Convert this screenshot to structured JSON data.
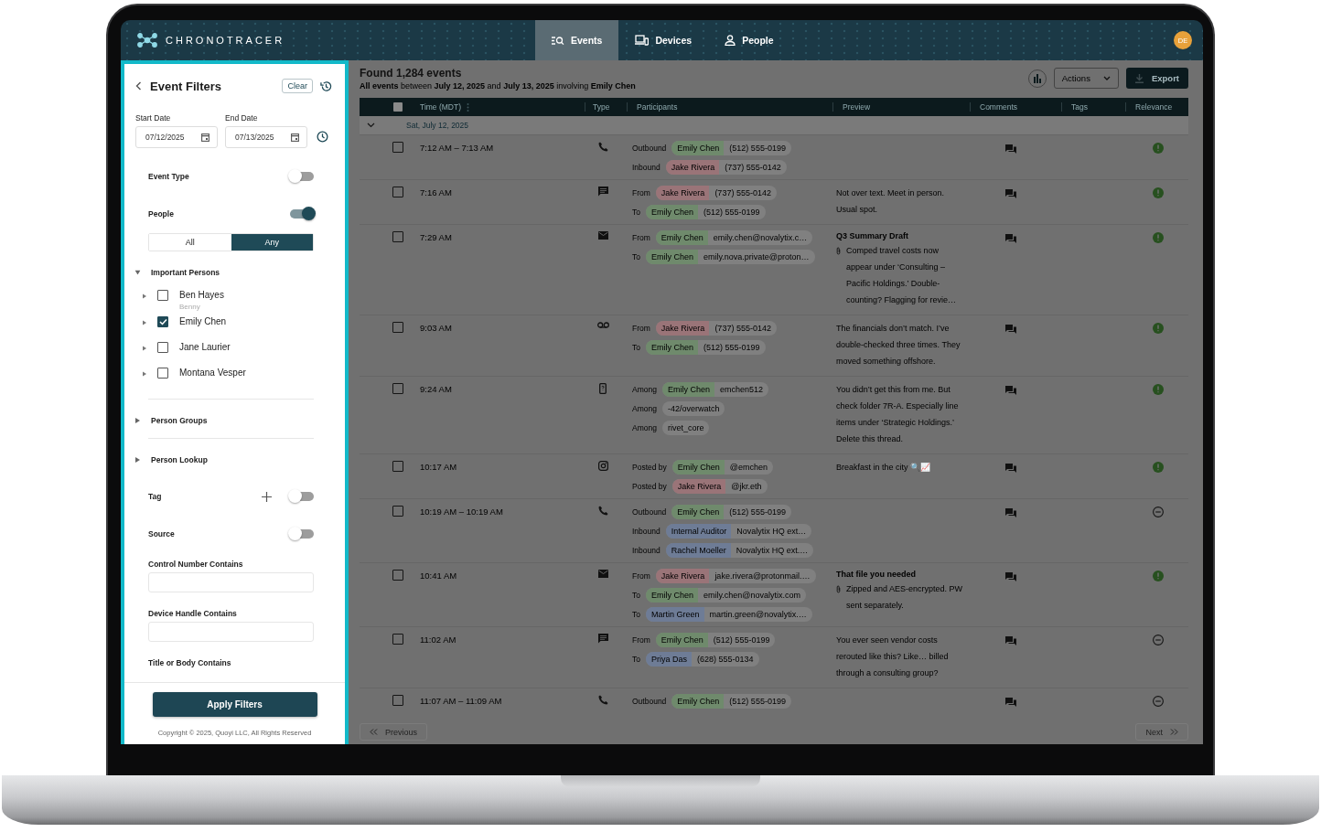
{
  "app": {
    "logo": "CHRONOTRACER",
    "avatar": "DE"
  },
  "nav": [
    {
      "label": "Events",
      "kind": "events",
      "selected": true
    },
    {
      "label": "Devices",
      "kind": "devices",
      "selected": false
    },
    {
      "label": "People",
      "kind": "people",
      "selected": false
    }
  ],
  "filters": {
    "title": "Event Filters",
    "clear": "Clear",
    "start_date": {
      "label": "Start Date",
      "value": "07/12/2025"
    },
    "end_date": {
      "label": "End Date",
      "value": "07/13/2025"
    },
    "items": [
      {
        "kind": "toggle",
        "label": "Event Type",
        "on": false
      },
      {
        "kind": "toggle",
        "label": "People",
        "on": true
      },
      {
        "kind": "segmented",
        "options": [
          {
            "label": "All",
            "selected": false
          },
          {
            "label": "Any",
            "selected": true
          }
        ]
      },
      {
        "kind": "group",
        "label": "Important Persons",
        "expanded": true,
        "people": [
          {
            "name": "Ben Hayes",
            "alias": "Benny",
            "checked": false,
            "expanded": false
          },
          {
            "name": "Emily Chen",
            "checked": true,
            "expanded": false
          },
          {
            "name": "Jane Laurier",
            "checked": false,
            "expanded": false
          },
          {
            "name": "Montana Vesper",
            "checked": false,
            "expanded": false
          }
        ]
      },
      {
        "kind": "group",
        "label": "Person Groups",
        "expanded": false
      },
      {
        "kind": "group",
        "label": "Person Lookup",
        "expanded": false
      },
      {
        "kind": "add_toggle",
        "label": "Tag",
        "on": false
      },
      {
        "kind": "toggle",
        "label": "Source",
        "on": false
      },
      {
        "kind": "text_field",
        "label": "Control Number Contains"
      },
      {
        "kind": "text_field",
        "label": "Device Handle Contains"
      },
      {
        "kind": "text_field",
        "label": "Title or Body Contains"
      }
    ],
    "apply": "Apply Filters",
    "copyright": "Copyright © 2025, Quoyi LLC, All Rights Reserved"
  },
  "results": {
    "title": "Found 1,284 events",
    "subtitle": "**All events** between **July 12, 2025** and **July 13, 2025** involving **Emily Chen**",
    "actions": "Actions",
    "export": "Export"
  },
  "table": {
    "select_all_checked": false,
    "columns": [
      "Time (MDT)",
      "Type",
      "Participants",
      "Preview",
      "Comments",
      "Tags",
      "Relevance"
    ],
    "group": {
      "label": "Sat, July 12, 2025",
      "expanded": true
    },
    "rows": [
      {
        "time": "7:12 AM – 7:13 AM",
        "kind": "call",
        "checked": false,
        "flagged": true,
        "participants": [
          {
            "role": "Outbound",
            "name": "Emily Chen",
            "handle": "(512) 555-0199",
            "color": "#6f8a6c"
          },
          {
            "role": "Inbound",
            "name": "Jake Rivera",
            "handle": "(737) 555-0142",
            "color": "#9a7478"
          }
        ]
      },
      {
        "time": "7:16 AM",
        "kind": "sms",
        "checked": false,
        "flagged": true,
        "participants": [
          {
            "role": "From",
            "name": "Jake Rivera",
            "handle": "(737) 555-0142",
            "color": "#9a7478"
          },
          {
            "role": "To",
            "name": "Emily Chen",
            "handle": "(512) 555-0199",
            "color": "#6f8a6c"
          }
        ],
        "preview": {
          "text": "Not over text. Meet in person. Usual spot."
        }
      },
      {
        "time": "7:29 AM",
        "kind": "email",
        "checked": false,
        "flagged": true,
        "participants": [
          {
            "role": "From",
            "name": "Emily Chen",
            "handle": "emily.chen@novalytix.c…",
            "color": "#6f8a6c"
          },
          {
            "role": "To",
            "name": "Emily Chen",
            "handle": "emily.nova.private@proton…",
            "color": "#6f8a6c"
          }
        ],
        "preview": {
          "title": "Q3 Summary Draft",
          "attachment": true,
          "text": "Comped travel costs now appear under ‘Consulting – Pacific Holdings.’ Double-counting? Flagging for revie…"
        }
      },
      {
        "time": "9:03 AM",
        "kind": "voicemail",
        "checked": false,
        "flagged": true,
        "participants": [
          {
            "role": "From",
            "name": "Jake Rivera",
            "handle": "(737) 555-0142",
            "color": "#9a7478"
          },
          {
            "role": "To",
            "name": "Emily Chen",
            "handle": "(512) 555-0199",
            "color": "#6f8a6c"
          }
        ],
        "preview": {
          "text": "The financials don’t match. I’ve double-checked three times. They moved something offshore."
        }
      },
      {
        "time": "9:24 AM",
        "kind": "device",
        "checked": false,
        "flagged": true,
        "participants": [
          {
            "role": "Among",
            "name": "Emily Chen",
            "handle": "emchen512",
            "color": "#6f8a6c"
          },
          {
            "role": "Among",
            "handle": "-42/overwatch"
          },
          {
            "role": "Among",
            "handle": "rivet_core"
          }
        ],
        "preview": {
          "text": "You didn’t get this from me. But check folder 7R-A. Especially line items under ‘Strategic Holdings.’ Delete this thread."
        }
      },
      {
        "time": "10:17 AM",
        "kind": "social",
        "checked": false,
        "flagged": true,
        "participants": [
          {
            "role": "Posted by",
            "name": "Emily Chen",
            "handle": "@emchen",
            "color": "#6f8a6c"
          },
          {
            "role": "Posted by",
            "name": "Jake Rivera",
            "handle": "@jkr.eth",
            "color": "#9a7478"
          }
        ],
        "preview": {
          "text": "Breakfast in the city 🔍📈"
        }
      },
      {
        "time": "10:19 AM – 10:19 AM",
        "kind": "call",
        "checked": false,
        "flagged": false,
        "participants": [
          {
            "role": "Outbound",
            "name": "Emily Chen",
            "handle": "(512) 555-0199",
            "color": "#6f8a6c"
          },
          {
            "role": "Inbound",
            "name": "Internal Auditor",
            "handle": "Novalytix HQ ext…",
            "color": "#6e7c96"
          },
          {
            "role": "Inbound",
            "name": "Rachel Moeller",
            "handle": "Novalytix HQ ext.…",
            "color": "#6e7c96"
          }
        ]
      },
      {
        "time": "10:41 AM",
        "kind": "email",
        "checked": false,
        "flagged": true,
        "participants": [
          {
            "role": "From",
            "name": "Jake Rivera",
            "handle": "jake.rivera@protonmail.…",
            "color": "#9a7478"
          },
          {
            "role": "To",
            "name": "Emily Chen",
            "handle": "emily.chen@novalytix.com",
            "color": "#6f8a6c"
          },
          {
            "role": "To",
            "name": "Martin Green",
            "handle": "martin.green@novalytix.…",
            "color": "#6e7c96"
          }
        ],
        "preview": {
          "title": "That file you needed",
          "attachment": true,
          "text": "Zipped and AES-encrypted. PW sent separately."
        }
      },
      {
        "time": "11:02 AM",
        "kind": "sms",
        "checked": false,
        "flagged": false,
        "participants": [
          {
            "role": "From",
            "name": "Emily Chen",
            "handle": "(512) 555-0199",
            "color": "#6f8a6c"
          },
          {
            "role": "To",
            "name": "Priya Das",
            "handle": "(628) 555-0134",
            "color": "#6e7c96"
          }
        ],
        "preview": {
          "text": "You ever seen vendor costs rerouted like this? Like… billed through a consulting group?"
        }
      },
      {
        "time": "11:07 AM – 11:09 AM",
        "kind": "call",
        "checked": false,
        "flagged": false,
        "participants": [
          {
            "role": "Outbound",
            "name": "Emily Chen",
            "handle": "(512) 555-0199",
            "color": "#6f8a6c"
          }
        ]
      }
    ]
  },
  "pagination": {
    "previous": "Previous",
    "next": "Next"
  }
}
